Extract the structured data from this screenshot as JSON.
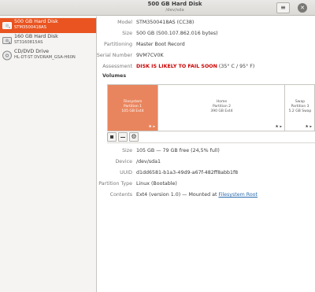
{
  "header": {
    "title": "500 GB Hard Disk",
    "subtitle": "/dev/sda",
    "menu_icon": "hamburger-icon",
    "close_icon": "close-icon"
  },
  "sidebar": {
    "drives": [
      {
        "name": "500 GB Hard Disk",
        "model": "STM3500418AS",
        "icon": "harddisk-icon",
        "selected": true
      },
      {
        "name": "160 GB Hard Disk",
        "model": "ST3160815AS",
        "icon": "harddisk-icon",
        "selected": false
      },
      {
        "name": "CD/DVD Drive",
        "model": "HL-DT-ST DVDRAM_GSA-H60N",
        "icon": "optical-drive-icon",
        "selected": false
      }
    ]
  },
  "disk_info": {
    "model": {
      "label": "Model",
      "value": "STM3500418AS (CC38)"
    },
    "size": {
      "label": "Size",
      "value": "500 GB (500.107.862.016 bytes)"
    },
    "partitioning": {
      "label": "Partitioning",
      "value": "Master Boot Record"
    },
    "serial": {
      "label": "Serial Number",
      "value": "9VM7CV0K"
    },
    "assessment": {
      "label": "Assessment",
      "warning": "DISK IS LIKELY TO FAIL SOON",
      "temp": " (35° C / 95° F)"
    }
  },
  "volumes": {
    "heading": "Volumes",
    "partitions": [
      {
        "line1": "Filesystem",
        "line2": "Partition 1",
        "line3": "105 GB Ext4",
        "stars": "★ ▸"
      },
      {
        "line1": "Home",
        "line2": "Partition 2",
        "line3": "390 GB Ext4",
        "stars": "★ ▸"
      },
      {
        "line1": "Swap",
        "line2": "Partition 3",
        "line3": "5.2 GB Swap",
        "stars": "★ ▸"
      }
    ],
    "tools": {
      "stop_icon": "stop-icon",
      "minus_icon": "minus-icon",
      "settings_icon": "gears-icon"
    }
  },
  "volume_details": {
    "size": {
      "label": "Size",
      "value": "105 GB — 79 GB free (24,5% full)"
    },
    "device": {
      "label": "Device",
      "value": "/dev/sda1"
    },
    "uuid": {
      "label": "UUID",
      "value": "d1dd6581-b1a3-49d9-a67f-482ff8abb1f8"
    },
    "partition_type": {
      "label": "Partition Type",
      "value": "Linux (Bootable)"
    },
    "contents": {
      "label": "Contents",
      "prefix": "Ext4 (version 1.0) — Mounted at ",
      "link": "Filesystem Root"
    }
  },
  "colors": {
    "accent": "#e95420",
    "selected_partition": "#e9855e",
    "warning": "#cc0000",
    "link": "#2a6bb0"
  }
}
